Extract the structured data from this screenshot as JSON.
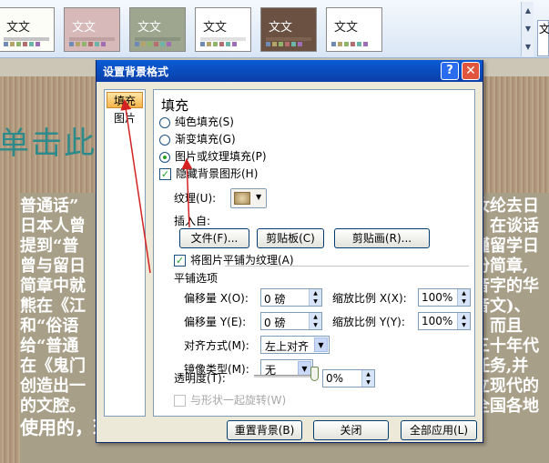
{
  "ribbon": {
    "themes": [
      {
        "label": "文文",
        "bg": "#fdfdf7",
        "fg": "#222222",
        "bar": "#c4c4c4"
      },
      {
        "label": "文文",
        "bg": "#d7b9b9",
        "fg": "#ffffff",
        "bar": "#bfa1a1"
      },
      {
        "label": "文文",
        "bg": "#9ea690",
        "fg": "#ffffff",
        "bar": "#8a9280"
      },
      {
        "label": "文文",
        "bg": "#ffffff",
        "fg": "#222222",
        "bar": "#e0e0e0"
      },
      {
        "label": "文文",
        "bg": "#6a5141",
        "fg": "#ffffff",
        "bar": "#7d6250"
      },
      {
        "label": "文文",
        "bg": "#ffffff",
        "fg": "#222222",
        "bar": "#ffffff"
      }
    ],
    "right_text": "文"
  },
  "slide": {
    "title": "单击此",
    "lines": [
      {
        "left": "普通话”",
        "right": "汝纶去日"
      },
      {
        "left": "日本人曾",
        "right": "。在谈话"
      },
      {
        "left": "提到“普",
        "right": "瑾留学日"
      },
      {
        "left": "曾与留日",
        "right": "份简章,"
      },
      {
        "left": "简章中就",
        "right": "音字的华"
      },
      {
        "left": "熊在《江",
        "right": "音文)、"
      },
      {
        "left": "和“俗语",
        "right": "。而且"
      },
      {
        "left": "给“普通",
        "right": "三十年代"
      },
      {
        "left": "在《鬼门",
        "right": "任务,并"
      },
      {
        "left": "创造出一",
        "right": "立现代的"
      },
      {
        "left": "的文腔。",
        "right": "全国各地"
      },
      {
        "left": "使用的，现代“人话”的，多音节的，有结尾",
        "right": ""
      }
    ]
  },
  "dialog": {
    "title": "设置背景格式",
    "help": "?",
    "close": "✕",
    "side_items": [
      "填充",
      "图片"
    ],
    "heading": "填充",
    "radios": [
      "纯色填充(S)",
      "渐变填充(G)",
      "图片或纹理填充(P)"
    ],
    "selected_radio": 2,
    "hide_bg": "隐藏背景图形(H)",
    "texture_label": "纹理(U):",
    "insert_from": "插入自:",
    "file_btn": "文件(F)...",
    "clipboard_btn": "剪贴板(C)",
    "clipart_btn": "剪贴画(R)...",
    "tile_check": "将图片平铺为纹理(A)",
    "tile_options": "平铺选项",
    "offset_x_label": "偏移量 X(O):",
    "offset_x": "0 磅",
    "scale_x_label": "缩放比例 X(X):",
    "scale_x": "100%",
    "offset_y_label": "偏移量 Y(E):",
    "offset_y": "0 磅",
    "scale_y_label": "缩放比例 Y(Y):",
    "scale_y": "100%",
    "align_label": "对齐方式(M):",
    "align_value": "左上对齐",
    "mirror_label": "镜像类型(M):",
    "mirror_value": "无",
    "transparency_label": "透明度(T):",
    "transparency_value": "0%",
    "transparency": 0,
    "rotate_with_shape": "与形状一起旋转(W)",
    "reset_btn": "重置背景(B)",
    "close_btn": "关闭",
    "apply_all_btn": "全部应用(L)"
  }
}
